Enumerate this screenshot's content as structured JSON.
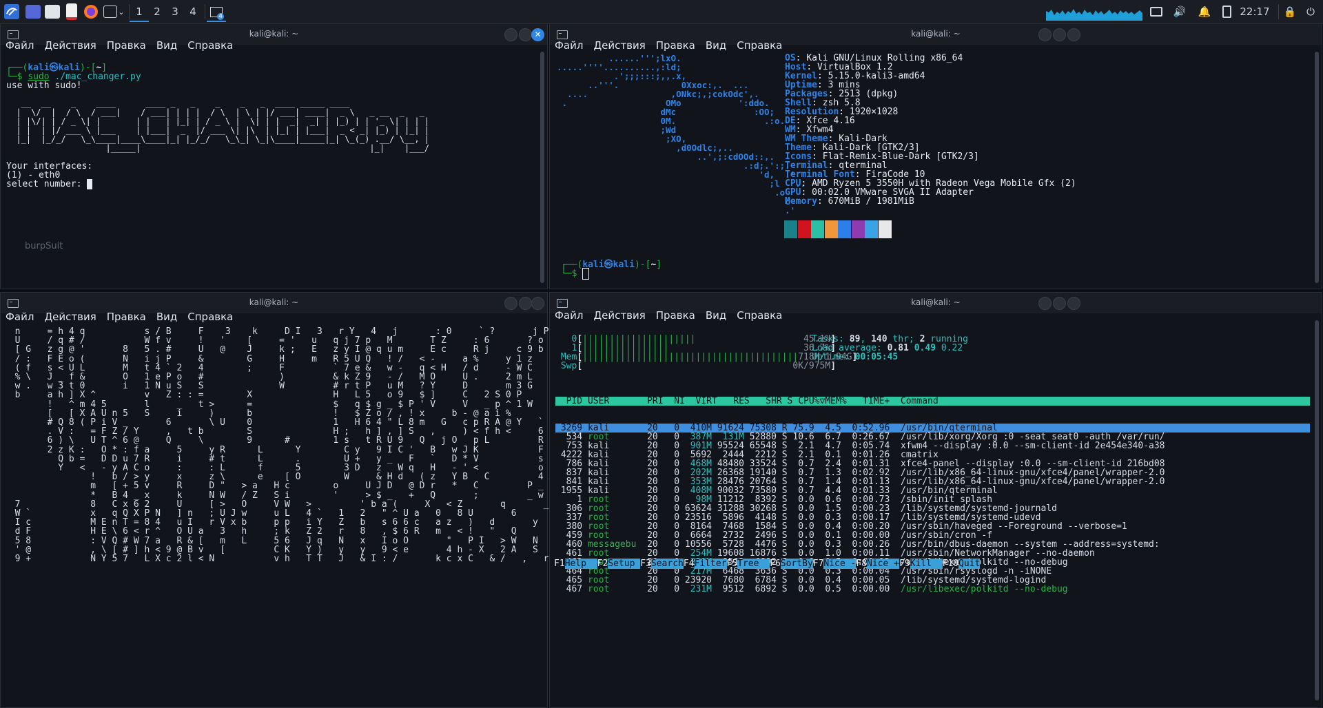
{
  "taskbar": {
    "workspaces": [
      "1",
      "2",
      "3",
      "4"
    ],
    "clock": "22:17",
    "terminal_count": "4"
  },
  "menu": [
    "Файл",
    "Действия",
    "Правка",
    "Вид",
    "Справка"
  ],
  "windows": {
    "tl": {
      "title": "kali@kali: ~",
      "prompt_user": "kali",
      "prompt_host": "kali",
      "prompt_dir": "~",
      "command_sudo": "sudo",
      "command_rest": "./mac_changer.py",
      "lines": [
        "use with sudo!"
      ],
      "ascii_art": "   __  __    _    ____      ____ _   _    _    _   _  ____ _____ ____\n  |  \\/  |  / \\  / ___|    / ___| | | |  / \\  | \\ | |/ ___| ____|  _ \\   _ __  _   _\n  | |\\/| | / _ \\| |       | |   | |_| | / _ \\ |  \\| | |  _|  _| | |_) | | '_ \\| | | |\n  | |  | |/ ___ \\ |___    | |___|  _  |/ ___ \\| |\\  | |_| | |___|  _ < _| |_) | |_| |\n  |_|  |_/_/   \\_\\____|____\\____|_| |_/_/   \\_\\_| \\_|\\____|_____|_| \\_(_) .__/ \\__, |\n                    |_____|                                              |_|    |___/",
      "interfaces_label": "Your interfaces:",
      "interface_1": "(1) - eth0",
      "select_label": "select number: "
    },
    "tr": {
      "title": "kali@kali: ~",
      "logo": "          ......''';lxO.\n.....''''..........,:ld;\n           .';;;:::;,,.x,\n      ..'''.            0Xxoc:,.  ...\n  ....                ,ONkc;,;cokOdc',.\n .                   OMo           ':ddo.\n                    dMc               :OO;\n                    0M.                 .:o.\n                    ;Wd\n                     ;XO,\n                       ,d0Odlc;,..\n                           ..',;:cdOOd::,.\n                                    .:d;.':;.\n                                       'd,  .'\n                                         ;l   ..\n                                          .o\n                                            c\n                                            .'\n                                             .",
      "info": [
        {
          "k": "OS",
          "v": "Kali GNU/Linux Rolling x86_64"
        },
        {
          "k": "Host",
          "v": "VirtualBox 1.2"
        },
        {
          "k": "Kernel",
          "v": "5.15.0-kali3-amd64"
        },
        {
          "k": "Uptime",
          "v": "3 mins"
        },
        {
          "k": "Packages",
          "v": "2513 (dpkg)"
        },
        {
          "k": "Shell",
          "v": "zsh 5.8"
        },
        {
          "k": "Resolution",
          "v": "1920×1028"
        },
        {
          "k": "DE",
          "v": "Xfce 4.16"
        },
        {
          "k": "WM",
          "v": "Xfwm4"
        },
        {
          "k": "WM Theme",
          "v": "Kali-Dark"
        },
        {
          "k": "Theme",
          "v": "Kali-Dark [GTK2/3]"
        },
        {
          "k": "Icons",
          "v": "Flat-Remix-Blue-Dark [GTK2/3]"
        },
        {
          "k": "Terminal",
          "v": "qterminal"
        },
        {
          "k": "Terminal Font",
          "v": "FiraCode 10"
        },
        {
          "k": "CPU",
          "v": "AMD Ryzen 5 3550H with Radeon Vega Mobile Gfx (2)"
        },
        {
          "k": "GPU",
          "v": "00:02.0 VMware SVGA II Adapter"
        },
        {
          "k": "Memory",
          "v": "670MiB / 1981MiB"
        }
      ],
      "palette": [
        "#1b8189",
        "#d0141d",
        "#2bc0a6",
        "#f2963b",
        "#2d7ee8",
        "#8e3bb0",
        "#3aa3e6",
        "#e8e8e8"
      ],
      "prompt_user": "kali",
      "prompt_host": "kali",
      "prompt_dir": "~"
    },
    "bl": {
      "title": "kali@kali: ~",
      "matrix": "  n     = h 4 q           s / B     F    3    k     D I   3   r Y   4   j       : 0     ` ?       j P   7     $ Y 8 e <\n  U     / q # /           W f v     !   '    [     = '   u   q j 7 p   M       T Z     : 6       ? o   d       i 6 ;\n  [ G   z g @ '       8   5 . #     U   @    J     k ;   E   z y I @ q u m     E c     R j     c 9 b   7     \\ 8 (\n  / :   F E o (       N   i j P     &        G     H     m   R 5 U Q   ! /   < -     a %     y 1 z   l       _   2\n  ( f   s < U L       M   t 4 ` 2   4        ;     F         ` 7 e &   w -   q < H   / d     - W C   y       '   u\n  % \\   J _ f &       O   1 e P o   #              )         & k Z 9   - /   M O     U .     2 m L   \\           (\n  w .   w 3 t 0       i   1 N u S   S              W         # r t P   u M   ? Y     D       m 3 G   i           K\n  b     a h ] X ^         v   Z : : =        X               H   L 5   o 9   $ ]     C   2 S 0 P               -\n        !   ^ m 4 5       l     _   t >      =               $   q $ g _ $ P ' V     V   _ p ^ 1 W             >\n        [   [ X A U n 5   S     i     )      b               !   $ Z o / , ! x     b - @ a i %             X\n        # Q 8 ( P i V _       6       \\ U    0               1   H 6 4 \" L 8 m   G   c p R A @ Y   `\n        . V :   = F Z / Y     ,   t b        S               H ;   h ] , ] S   ,     ) < f h <     6 -\n        6 ) \\   U T ^ 6 @     Q     \\        9      #        1 s   t R U 9   Q   j O   p L         R v\n        2 z K :   O * : f a     5     y R      L      Y        C y   9 I C '   B   w J K           F u\n          Q b =   D D u 7 R     i     # t      L      .        U +   y _   F   `   D * V           s q\n          Y   <   - y A C o     :     : L      f      5        3 D   z   W q   H   - ' <           o 4\n                !   b / > y     x     z \\      e    [ O        W     & H d   ( z   Y B   C         4 X\n                m   [ + 5 v     R     D \"   > a   H c        o     U J D   @ D r   *   C         P _\n                *   B 4 _ x     k     N W   / Z   S i        '     > $ _   +   Q       ;         _ w\n  7             8   C x 6 2     U     [ >   O     V W   >         ' b a (     X   < Z       q       _ w\n  W `           x   q Q X P N   ] n   ; U J w     u L   4 `   1   2   \" ^ U a   0   8 U       6       % =\n  I c           M E n T = 8 4   u I   r V x b     p p   i Y   Z   b   s 6 6 c   a z   )   d       y       !\n  d F           H E \\ 6 < r ^   O U a   3   h     ; k   Z 2   r   8   , $ 6 R   m   < !   \"   Q       ; Z\n  5 8           : V Q # W 7 a   R & [   m   L     5 6   J q   N   x   I o O       \"   P I   > W   N   E G <         c\n  ' @           , \\ [ # ] h < 9 @ B v   [         C K   Y )   y   y   9 < e       4 h - X   2 A   S   U z $   !   \\ l\n  9 +           N Y 5 7   L X c 2 l < N           v h   T T   J   & I : /       k c x C   & /   ,   r   u   6 ?"
    },
    "br": {
      "title": "kali@kali: ~",
      "meters": [
        {
          "label": "0",
          "bar": "|||||||||||||||||||||",
          "val": "45.1%"
        },
        {
          "label": "1",
          "bar": "||||||||||||||||",
          "val": "36.7%"
        },
        {
          "label": "Mem",
          "bar": "||||||||||||||||||||||||||||||||||||||||",
          "val": "718M/1.94G"
        },
        {
          "label": "Swp",
          "bar": "",
          "val": "0K/975M"
        }
      ],
      "tasks_label": "Tasks:",
      "tasks_val": "89",
      "thr_val": "140",
      "running_val": "2",
      "load_label": "Load average:",
      "load_1": "0.81",
      "load_2": "0.49",
      "load_3": "0.22",
      "uptime_label": "Uptime:",
      "uptime_val": "00:05:45",
      "header": "  PID USER       PRI  NI  VIRT   RES   SHR S CPU%▽MEM%   TIME+  Command",
      "procs": [
        {
          "pid": "3269",
          "user": "kali",
          "pri": "20",
          "ni": "0",
          "virt": "410M",
          "res": "91624",
          "shr": "75308",
          "s": "R",
          "cpu": "75.9",
          "mem": "4.5",
          "time": "0:52.96",
          "cmd": "/usr/bin/qterminal"
        },
        {
          "pid": "534",
          "user": "root",
          "pri": "20",
          "ni": "0",
          "virt": "387M",
          "res": "131M",
          "shr": "52880",
          "s": "S",
          "cpu": "10.6",
          "mem": "6.7",
          "time": "0:26.67",
          "cmd": "/usr/lib/xorg/Xorg :0 -seat seat0 -auth /var/run/"
        },
        {
          "pid": "753",
          "user": "kali",
          "pri": "20",
          "ni": "0",
          "virt": "901M",
          "res": "95524",
          "shr": "65548",
          "s": "S",
          "cpu": "2.1",
          "mem": "4.7",
          "time": "0:05.74",
          "cmd": "xfwm4 --display :0.0 --sm-client-id 2e454e340-a38"
        },
        {
          "pid": "4222",
          "user": "kali",
          "pri": "20",
          "ni": "0",
          "virt": "5692",
          "res": "2444",
          "shr": "2212",
          "s": "S",
          "cpu": "2.1",
          "mem": "0.1",
          "time": "0:01.26",
          "cmd": "cmatrix"
        },
        {
          "pid": "786",
          "user": "kali",
          "pri": "20",
          "ni": "0",
          "virt": "468M",
          "res": "48480",
          "shr": "33524",
          "s": "S",
          "cpu": "0.7",
          "mem": "2.4",
          "time": "0:01.31",
          "cmd": "xfce4-panel --display :0.0 --sm-client-id 216bd08"
        },
        {
          "pid": "837",
          "user": "kali",
          "pri": "20",
          "ni": "0",
          "virt": "202M",
          "res": "26368",
          "shr": "19140",
          "s": "S",
          "cpu": "0.7",
          "mem": "1.3",
          "time": "0:02.92",
          "cmd": "/usr/lib/x86_64-linux-gnu/xfce4/panel/wrapper-2.0"
        },
        {
          "pid": "841",
          "user": "kali",
          "pri": "20",
          "ni": "0",
          "virt": "353M",
          "res": "28476",
          "shr": "20764",
          "s": "S",
          "cpu": "0.7",
          "mem": "1.4",
          "time": "0:01.13",
          "cmd": "/usr/lib/x86_64-linux-gnu/xfce4/panel/wrapper-2.0"
        },
        {
          "pid": "1955",
          "user": "kali",
          "pri": "20",
          "ni": "0",
          "virt": "408M",
          "res": "90032",
          "shr": "73580",
          "s": "S",
          "cpu": "0.7",
          "mem": "4.4",
          "time": "0:01.33",
          "cmd": "/usr/bin/qterminal"
        },
        {
          "pid": "1",
          "user": "root",
          "pri": "20",
          "ni": "0",
          "virt": "98M",
          "res": "11212",
          "shr": "8392",
          "s": "S",
          "cpu": "0.0",
          "mem": "0.6",
          "time": "0:00.73",
          "cmd": "/sbin/init splash"
        },
        {
          "pid": "306",
          "user": "root",
          "pri": "20",
          "ni": "0",
          "virt": "63624",
          "res": "31288",
          "shr": "30268",
          "s": "S",
          "cpu": "0.0",
          "mem": "1.5",
          "time": "0:00.23",
          "cmd": "/lib/systemd/systemd-journald"
        },
        {
          "pid": "337",
          "user": "root",
          "pri": "20",
          "ni": "0",
          "virt": "23516",
          "res": "5896",
          "shr": "4148",
          "s": "S",
          "cpu": "0.0",
          "mem": "0.3",
          "time": "0:00.17",
          "cmd": "/lib/systemd/systemd-udevd"
        },
        {
          "pid": "380",
          "user": "root",
          "pri": "20",
          "ni": "0",
          "virt": "8164",
          "res": "7468",
          "shr": "1584",
          "s": "S",
          "cpu": "0.0",
          "mem": "0.4",
          "time": "0:00.20",
          "cmd": "/usr/sbin/haveged --Foreground --verbose=1"
        },
        {
          "pid": "459",
          "user": "root",
          "pri": "20",
          "ni": "0",
          "virt": "6664",
          "res": "2732",
          "shr": "2496",
          "s": "S",
          "cpu": "0.0",
          "mem": "0.1",
          "time": "0:00.00",
          "cmd": "/usr/sbin/cron -f"
        },
        {
          "pid": "460",
          "user": "messagebu",
          "pri": "20",
          "ni": "0",
          "virt": "10556",
          "res": "5728",
          "shr": "4476",
          "s": "S",
          "cpu": "0.0",
          "mem": "0.3",
          "time": "0:00.26",
          "cmd": "/usr/bin/dbus-daemon --system --address=systemd:"
        },
        {
          "pid": "461",
          "user": "root",
          "pri": "20",
          "ni": "0",
          "virt": "254M",
          "res": "19608",
          "shr": "16876",
          "s": "S",
          "cpu": "0.0",
          "mem": "1.0",
          "time": "0:00.11",
          "cmd": "/usr/sbin/NetworkManager --no-daemon"
        },
        {
          "pid": "463",
          "user": "root",
          "pri": "20",
          "ni": "0",
          "virt": "231M",
          "res": "9512",
          "shr": "6892",
          "s": "S",
          "cpu": "0.0",
          "mem": "0.5",
          "time": "0:00.12",
          "cmd": "/usr/libexec/polkitd --no-debug"
        },
        {
          "pid": "464",
          "user": "root",
          "pri": "20",
          "ni": "0",
          "virt": "217M",
          "res": "6468",
          "shr": "3636",
          "s": "S",
          "cpu": "0.0",
          "mem": "0.3",
          "time": "0:00.04",
          "cmd": "/usr/sbin/rsyslogd -n -iNONE"
        },
        {
          "pid": "465",
          "user": "root",
          "pri": "20",
          "ni": "0",
          "virt": "23920",
          "res": "7680",
          "shr": "6784",
          "s": "S",
          "cpu": "0.0",
          "mem": "0.4",
          "time": "0:00.05",
          "cmd": "/lib/systemd/systemd-logind"
        },
        {
          "pid": "467",
          "user": "root",
          "pri": "20",
          "ni": "0",
          "virt": "231M",
          "res": "9512",
          "shr": "6892",
          "s": "S",
          "cpu": "0.0",
          "mem": "0.5",
          "time": "0:00.00",
          "cmd": "/usr/libexec/polkitd --no-debug"
        }
      ],
      "fkeys": [
        {
          "k": "F1",
          "v": "Help  "
        },
        {
          "k": "F2",
          "v": "Setup "
        },
        {
          "k": "F3",
          "v": "Search"
        },
        {
          "k": "F4",
          "v": "Filter"
        },
        {
          "k": "F5",
          "v": "Tree  "
        },
        {
          "k": "F6",
          "v": "SortBy"
        },
        {
          "k": "F7",
          "v": "Nice -"
        },
        {
          "k": "F8",
          "v": "Nice +"
        },
        {
          "k": "F9",
          "v": "Kill  "
        },
        {
          "k": "F10",
          "v": "Quit"
        }
      ]
    }
  },
  "desktop_icons": [
    "burpSuit"
  ]
}
